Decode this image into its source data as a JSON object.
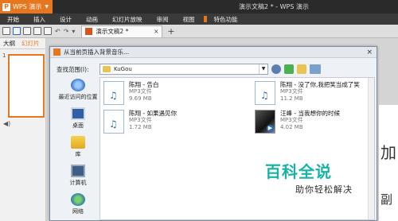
{
  "app": {
    "logo": "P",
    "name": "WPS 演示",
    "window_title": "演示文稿2 * - WPS 演示"
  },
  "ribbon": {
    "tabs": [
      "开始",
      "插入",
      "设计",
      "动画",
      "幻灯片放映",
      "审阅",
      "视图",
      "特色功能"
    ]
  },
  "docbar": {
    "doc_tab": "演示文稿2 *",
    "close": "×",
    "add": "+"
  },
  "leftpane": {
    "tabs": [
      "大纲",
      "幻灯片"
    ],
    "slide_number": "1"
  },
  "slide": {
    "text1": "加",
    "text2": "副"
  },
  "dialog": {
    "title": "从当前页插入背景音乐...",
    "close": "×",
    "lookin_label": "查找范围(I):",
    "lookin_value": "KuGou",
    "places": [
      "最近访问的位置",
      "桌面",
      "库",
      "计算机",
      "网络"
    ],
    "files": [
      {
        "name": "陈翔 - 告白",
        "type": "MP3文件",
        "size": "9.69 MB",
        "thumb": "mp3"
      },
      {
        "name": "陈翔 - 没了你,我把笑当成了笑",
        "type": "MP3文件",
        "size": "11.2 MB",
        "thumb": "mp3"
      },
      {
        "name": "陈翔 - 如果遇见你",
        "type": "MP3文件",
        "size": "1.72 MB",
        "thumb": "mp3"
      },
      {
        "name": "汪峰 - 当我想你的时候",
        "type": "MP3文件",
        "size": "4.02 MB",
        "thumb": "image"
      }
    ]
  },
  "watermark": {
    "line1": "百科全说",
    "line2": "助你轻松解决"
  },
  "colors": {
    "accent": "#e8761f",
    "watermark": "#19b3a6",
    "titlebar": "#2a2a2a"
  }
}
